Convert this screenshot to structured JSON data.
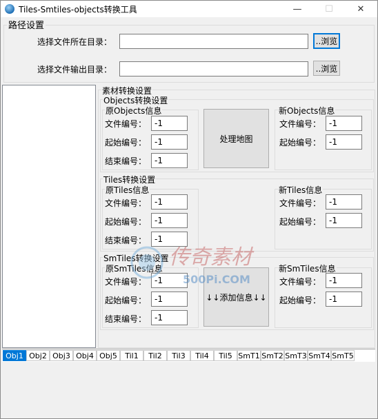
{
  "window": {
    "title": "Tiles-Smtiles-objects转换工具",
    "icon": "globe-app-icon",
    "minimize_glyph": "—",
    "maximize_glyph": "☐",
    "close_glyph": "✕"
  },
  "path_settings": {
    "group_label": "路径设置",
    "source_label": "选择文件所在目录：",
    "source_value": "",
    "browse1_label": "..浏览",
    "output_label": "选择文件输出目录：",
    "output_value": "",
    "browse2_label": "..浏览"
  },
  "material": {
    "group_label": "素材转换设置",
    "objects": {
      "group_label": "Objects转换设置",
      "orig_label": "原Objects信息",
      "new_label": "新Objects信息",
      "file_no_label": "文件编号：",
      "start_no_label": "起始编号：",
      "end_no_label": "结束编号：",
      "orig_file_no": "-1",
      "orig_start_no": "-1",
      "orig_end_no": "-1",
      "new_file_no": "-1",
      "new_start_no": "-1",
      "process_button": "处理地图"
    },
    "tiles": {
      "group_label": "Tiles转换设置",
      "orig_label": "原Tiles信息",
      "new_label": "新Tiles信息",
      "file_no_label": "文件编号：",
      "start_no_label": "起始编号：",
      "end_no_label": "结束编号：",
      "orig_file_no": "-1",
      "orig_start_no": "-1",
      "orig_end_no": "-1",
      "new_file_no": "-1",
      "new_start_no": "-1"
    },
    "smtiles": {
      "group_label": "SmTiles转换设置",
      "orig_label": "原SmTiles信息",
      "new_label": "新SmTiles信息",
      "file_no_label": "文件编号：",
      "start_no_label": "起始编号：",
      "end_no_label": "结束编号：",
      "orig_file_no": "-1",
      "orig_start_no": "-1",
      "orig_end_no": "-1",
      "new_file_no": "-1",
      "new_start_no": "-1",
      "add_button": "↓↓添加信息↓↓"
    }
  },
  "tabs": [
    "Obj1",
    "Obj2",
    "Obj3",
    "Obj4",
    "Obj5",
    "Til1",
    "Til2",
    "Til3",
    "Til4",
    "Til5",
    "SmT1",
    "SmT2",
    "SmT3",
    "SmT4",
    "SmT5"
  ],
  "active_tab": "Obj1",
  "watermark": {
    "main": "传奇素材",
    "sub": "500Pi.COM"
  },
  "colors": {
    "accent": "#0078d7",
    "window_bg": "#f0f0f0",
    "button_bg": "#e1e1e1"
  }
}
